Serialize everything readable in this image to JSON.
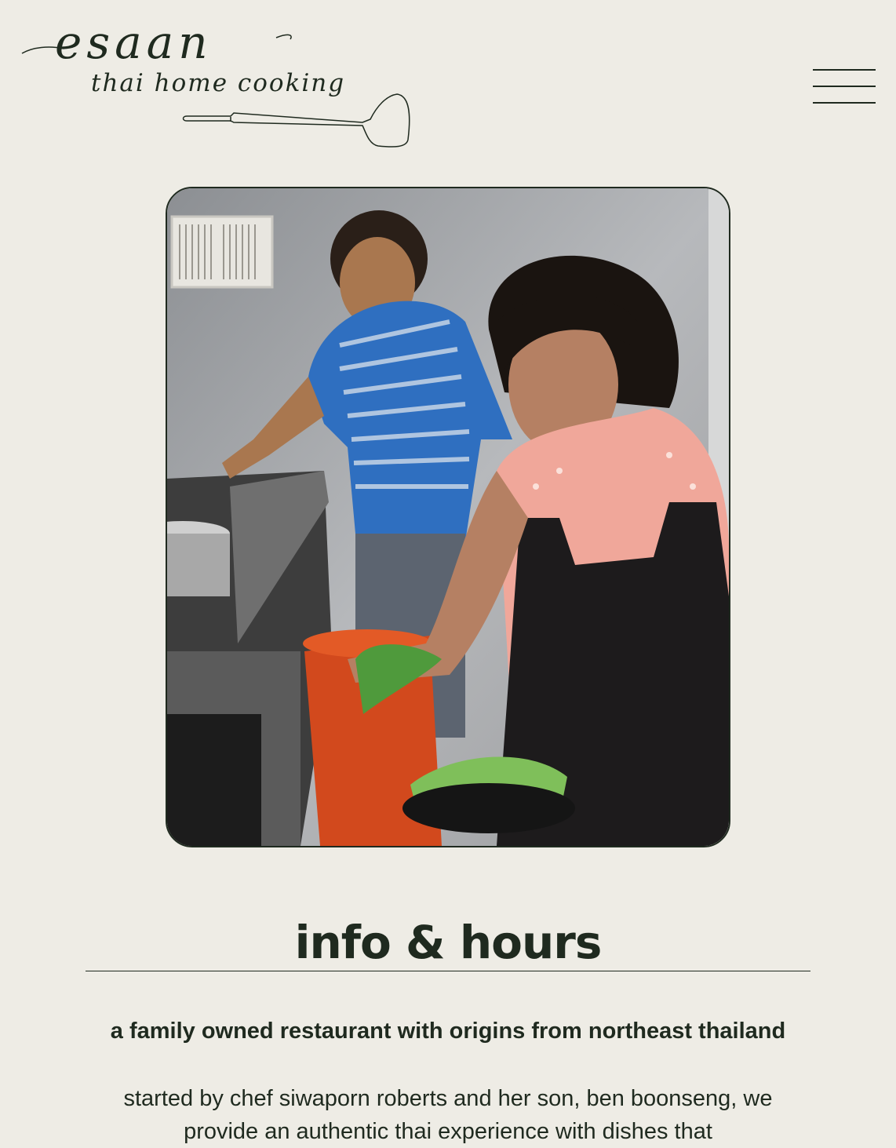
{
  "brand": {
    "name": "esaan",
    "tagline": "thai home cooking"
  },
  "menu": {
    "icon": "hamburger-menu-icon"
  },
  "hero_image": {
    "alt": "two cooks preparing food in a restaurant kitchen"
  },
  "content": {
    "heading": "info & hours",
    "subheading": "a family owned restaurant with origins from northeast thailand",
    "body": "started by chef siwaporn roberts and her son, ben boonseng, we provide an authentic thai experience with dishes that"
  },
  "colors": {
    "background": "#eeece5",
    "text": "#1f2a1f"
  }
}
